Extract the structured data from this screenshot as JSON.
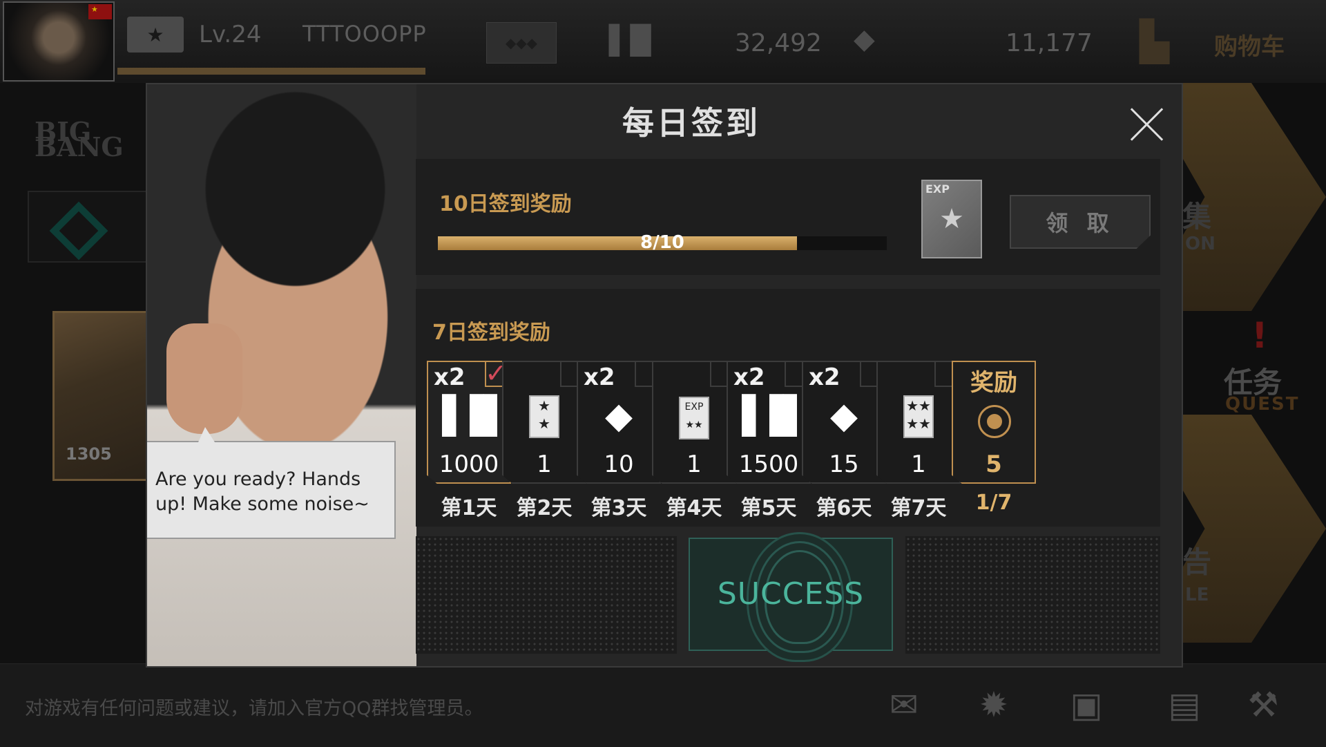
{
  "topbar": {
    "level": "Lv.24",
    "player_name": "TTTOOOPP",
    "currency1_value": "32,492",
    "currency2_value": "11,177",
    "shop_label": "购物车",
    "icons": {
      "level": "star-badge-icon",
      "currency1": "bars-icon",
      "currency2": "diamond-icon",
      "shop": "cart-icon"
    }
  },
  "side": {
    "card_power": "1305",
    "quest_cn": "任务",
    "quest_en": "QUEST",
    "frag_top_cn": "集",
    "frag_top_en": "ON",
    "frag_bot_cn": "告",
    "frag_bot_en": "LE"
  },
  "modal": {
    "title": "每日签到",
    "speech": "Are you ready? Hands up! Make some noise~",
    "ten_day": {
      "title": "10日签到奖励",
      "progress_text": "8/10",
      "progress_fraction": 0.8,
      "reward_label": "EXP",
      "claim_label": "领 取"
    },
    "seven_day": {
      "title": "7日签到奖励",
      "days": [
        {
          "mult": "x2",
          "icon": "bars-icon",
          "qty": "1000",
          "label": "第1天",
          "claimed": true
        },
        {
          "mult": "",
          "icon": "one-star-card-icon",
          "qty": "1",
          "label": "第2天",
          "claimed": false
        },
        {
          "mult": "x2",
          "icon": "diamond-icon",
          "qty": "10",
          "label": "第3天",
          "claimed": false
        },
        {
          "mult": "",
          "icon": "exp-card-icon",
          "qty": "1",
          "label": "第4天",
          "claimed": false
        },
        {
          "mult": "x2",
          "icon": "bars-icon",
          "qty": "1500",
          "label": "第5天",
          "claimed": false
        },
        {
          "mult": "x2",
          "icon": "diamond-icon",
          "qty": "15",
          "label": "第6天",
          "claimed": false
        },
        {
          "mult": "",
          "icon": "four-star-card-icon",
          "qty": "1",
          "label": "第7天",
          "claimed": false
        }
      ],
      "bonus": {
        "title": "奖励",
        "qty": "5",
        "progress": "1/7",
        "icon": "medal-icon"
      }
    },
    "success_label": "SUCCESS"
  },
  "bottombar": {
    "notice": "对游戏有任何问题或建议，请加入官方QQ群找管理员。",
    "icons": [
      "mail-icon",
      "settings-icon",
      "gift-icon",
      "notes-icon",
      "tools-icon"
    ]
  },
  "colors": {
    "gold": "#c99a52",
    "accent_green": "#4bb59c",
    "check_red": "#d24b5a"
  }
}
